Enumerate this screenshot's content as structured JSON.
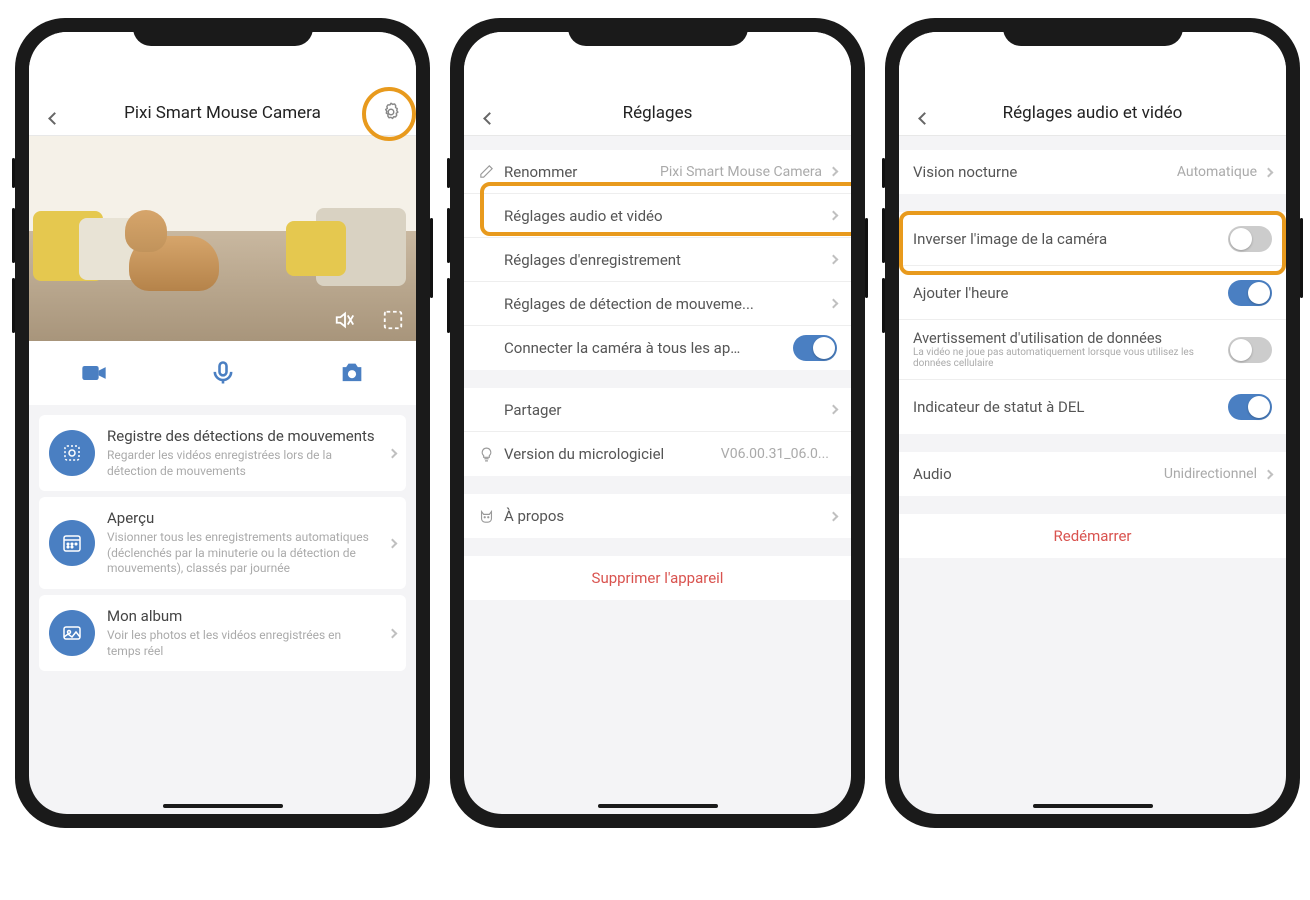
{
  "phone1": {
    "title": "Pixi Smart Mouse Camera",
    "menu": [
      {
        "title": "Registre des détections de mouvements",
        "desc": "Regarder les vidéos enregistrées lors de la détection de mouvements"
      },
      {
        "title": "Aperçu",
        "desc": "Visionner tous les enregistrements automatiques (déclenchés par la minuterie ou la détection de mouvements), classés par journée"
      },
      {
        "title": "Mon album",
        "desc": "Voir les photos et les vidéos enregistrées en temps réel"
      }
    ]
  },
  "phone2": {
    "title": "Réglages",
    "rename_label": "Renommer",
    "rename_value": "Pixi Smart Mouse Camera",
    "av_label": "Réglages audio et vidéo",
    "rec_label": "Réglages d'enregistrement",
    "motion_label": "Réglages de détection de mouveme...",
    "connect_label": "Connecter la caméra à tous les appar...",
    "share_label": "Partager",
    "fw_label": "Version du micrologiciel",
    "fw_value": "V06.00.31_06.0...",
    "about_label": "À propos",
    "delete": "Supprimer l'appareil"
  },
  "phone3": {
    "title": "Réglages audio et vidéo",
    "night_label": "Vision nocturne",
    "night_value": "Automatique",
    "flip_label": "Inverser l'image de la caméra",
    "time_label": "Ajouter l'heure",
    "data_label": "Avertissement d'utilisation de données",
    "data_sub": "La vidéo ne joue pas automatiquement lorsque vous utilisez les données cellulaire",
    "led_label": "Indicateur de statut à DEL",
    "audio_label": "Audio",
    "audio_value": "Unidirectionnel",
    "restart": "Redémarrer"
  }
}
